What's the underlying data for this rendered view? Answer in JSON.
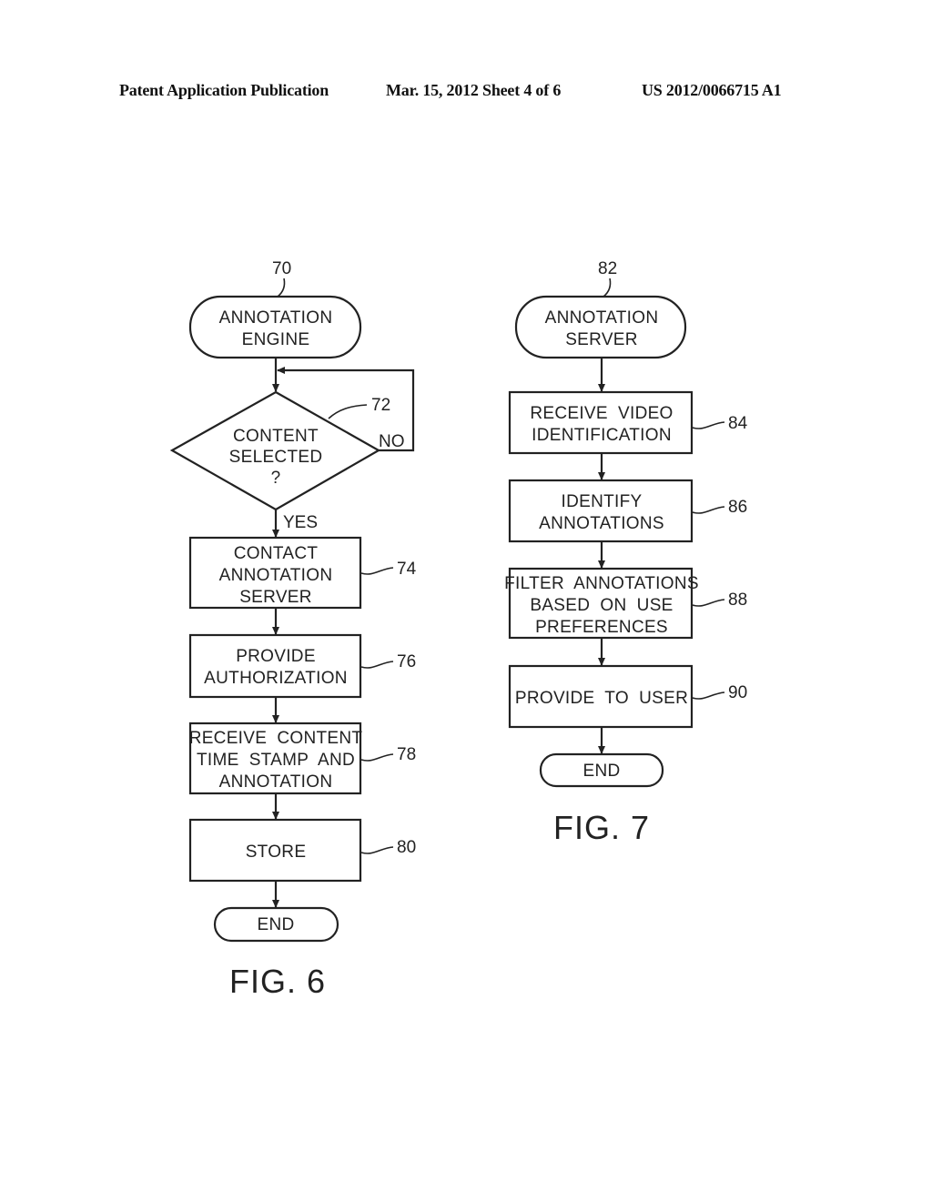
{
  "header": {
    "publication": "Patent Application Publication",
    "date_sheet": "Mar. 15, 2012  Sheet 4 of 6",
    "number": "US 2012/0066715 A1"
  },
  "fig6": {
    "label": "FIG. 6",
    "start": {
      "ref": "70",
      "lines": [
        "ANNOTATION",
        "ENGINE"
      ]
    },
    "decision": {
      "ref": "72",
      "lines": [
        "CONTENT",
        "SELECTED",
        "?"
      ],
      "yes": "YES",
      "no": "NO"
    },
    "steps": [
      {
        "ref": "74",
        "lines": [
          "CONTACT",
          "ANNOTATION",
          "SERVER"
        ]
      },
      {
        "ref": "76",
        "lines": [
          "PROVIDE",
          "AUTHORIZATION"
        ]
      },
      {
        "ref": "78",
        "lines": [
          "RECEIVE  CONTENT",
          "TIME  STAMP  AND",
          "ANNOTATION"
        ]
      },
      {
        "ref": "80",
        "lines": [
          "STORE"
        ]
      }
    ],
    "end": "END"
  },
  "fig7": {
    "label": "FIG. 7",
    "start": {
      "ref": "82",
      "lines": [
        "ANNOTATION",
        "SERVER"
      ]
    },
    "steps": [
      {
        "ref": "84",
        "lines": [
          "RECEIVE  VIDEO",
          "IDENTIFICATION"
        ]
      },
      {
        "ref": "86",
        "lines": [
          "IDENTIFY",
          "ANNOTATIONS"
        ]
      },
      {
        "ref": "88",
        "lines": [
          "FILTER  ANNOTATIONS",
          "BASED  ON  USE",
          "PREFERENCES"
        ]
      },
      {
        "ref": "90",
        "lines": [
          "PROVIDE  TO  USER"
        ]
      }
    ],
    "end": "END"
  }
}
